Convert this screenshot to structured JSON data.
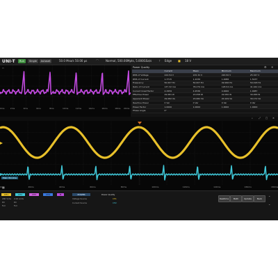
{
  "topbar": {
    "brand": "UNI-T",
    "run_state": "Run",
    "trigger_mode": "Single",
    "sweep": "Autoset",
    "sample_rate": "50.0 Msa/s",
    "time_offset": "50.00 µs",
    "acq_info": "Normal, 500.00Mpts, 5.000GSa/s",
    "trigger_type": "Edge",
    "trigger_level": "18 V"
  },
  "upper_plot": {
    "x_ticks": [
      "0ms",
      "2ms",
      "4ms",
      "6ms",
      "8ms",
      "10ms",
      "12ms",
      "14ms",
      "16ms",
      "18ms",
      "20ms"
    ]
  },
  "power_table": {
    "title": "Power Quality",
    "headers": [
      "",
      "Current",
      "Mean",
      "Minimum",
      "Maximum"
    ],
    "rows": [
      [
        "RMS of Voltage",
        "224.54 V",
        "215.32 V",
        "220.50 V",
        "25.347 V"
      ],
      [
        "RMS of Current",
        "1.3715",
        "1.2236",
        "1.0086",
        "1.5437"
      ],
      [
        "Frequency",
        "50.007 Hz",
        "50.007 Hz",
        "49.996 Hz",
        "50.018 Hz"
      ],
      [
        "Ratio of Current",
        "137.32 mA",
        "78.279 mA",
        "128.54 mA",
        "41.042 mA"
      ],
      [
        "Current Crest Factor",
        "4.2959",
        "4.2536",
        "4.0000",
        "1.0087"
      ],
      [
        "Effective Power",
        "29.081 W",
        "23.058 W",
        "22.050 W",
        "30.058 W"
      ],
      [
        "Apparent Power",
        "29.082 VA",
        "23.082 VA",
        "20.109 VA",
        "30.172 VA"
      ],
      [
        "Reactive Power",
        "0 Var",
        "0 Var",
        "0 Var",
        "0 Var"
      ],
      [
        "Power Factor",
        "1.0000",
        "1.0000",
        "1.0000",
        "1.0000"
      ],
      [
        "Phase Angle",
        "0°",
        "",
        "",
        ""
      ]
    ]
  },
  "lower_plot": {
    "window_label": "Main Window",
    "x_ticks": [
      "0ms",
      "20ms",
      "40ms",
      "60ms",
      "80ms",
      "100ms",
      "120ms",
      "140ms",
      "160ms",
      "180ms"
    ]
  },
  "bottom": {
    "channels": [
      {
        "label": "CH1",
        "color": "#e8c02a"
      },
      {
        "label": "CH2",
        "color": "#40c8d8"
      },
      {
        "label": "CH3",
        "color": "#d060e0"
      },
      {
        "label": "CH4",
        "color": "#3a7ae0"
      },
      {
        "label": "M",
        "color": "#b84ad8"
      }
    ],
    "ch_rows": [
      [
        "200 V/div",
        "DC",
        "Full"
      ],
      [
        "2.00 A/div",
        "DC",
        "Full"
      ],
      [
        "",
        "",
        ""
      ],
      [
        "",
        "",
        ""
      ]
    ],
    "power_tab": "POWER",
    "power_mode": "Power Quality",
    "source_rows": [
      {
        "label": "Voltage Source",
        "value": "CH1"
      },
      {
        "label": "Current Source",
        "value": "CH2"
      }
    ],
    "buttons": [
      "Realtime",
      "Math",
      "Update",
      "Back"
    ]
  },
  "colors": {
    "ch1": "#e8c02a",
    "ch2": "#40c8d8",
    "math": "#c24ae0"
  }
}
